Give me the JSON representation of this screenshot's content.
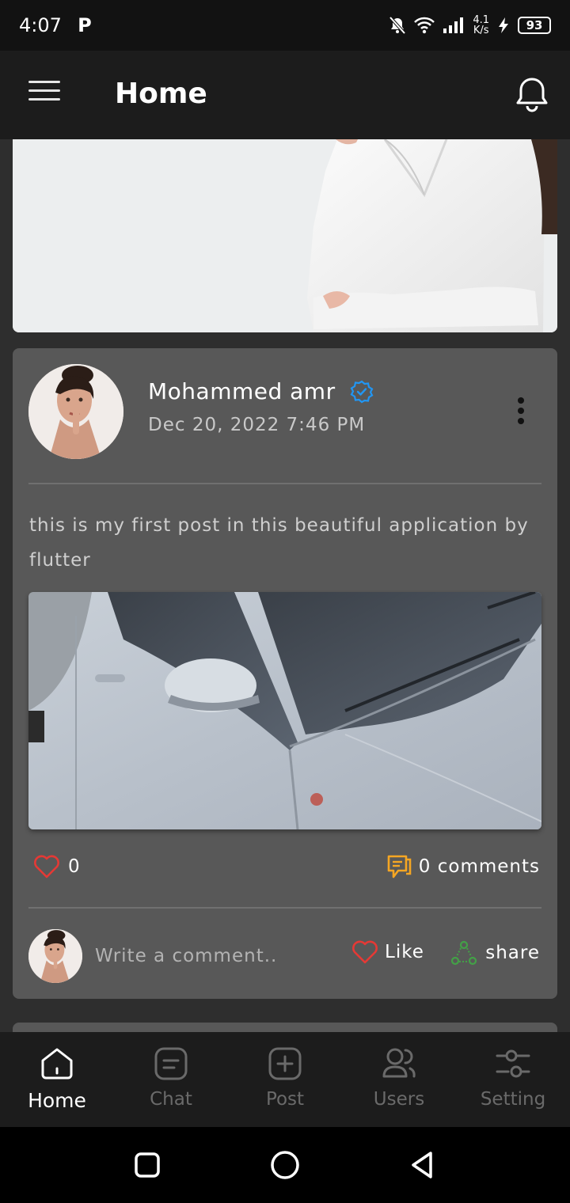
{
  "status_bar": {
    "time": "4:07",
    "app_badge": "P",
    "net_speed_value": "4.1",
    "net_speed_unit": "K/s",
    "battery": "93"
  },
  "app_bar": {
    "title": "Home",
    "menu_icon": "hamburger-menu-icon",
    "notification_icon": "bell-icon"
  },
  "post": {
    "author": "Mohammed amr",
    "verified": true,
    "date": "Dec 20, 2022 7:46 PM",
    "text": "this is my first post in this beautiful application by flutter",
    "likes": "0",
    "comments": "0 comments",
    "comment_placeholder": "Write a comment..",
    "like_label": "Like",
    "share_label": "share",
    "colors": {
      "like": "#e53935",
      "comment": "#f5a623",
      "share": "#43a047",
      "verified": "#2196f3"
    }
  },
  "bottom_nav": {
    "items": [
      {
        "label": "Home",
        "icon": "home-icon",
        "active": true
      },
      {
        "label": "Chat",
        "icon": "chat-icon",
        "active": false
      },
      {
        "label": "Post",
        "icon": "add-post-icon",
        "active": false
      },
      {
        "label": "Users",
        "icon": "users-icon",
        "active": false
      },
      {
        "label": "Setting",
        "icon": "settings-sliders-icon",
        "active": false
      }
    ]
  },
  "system_nav": {
    "recents_icon": "square-icon",
    "home_icon": "circle-icon",
    "back_icon": "triangle-back-icon"
  }
}
